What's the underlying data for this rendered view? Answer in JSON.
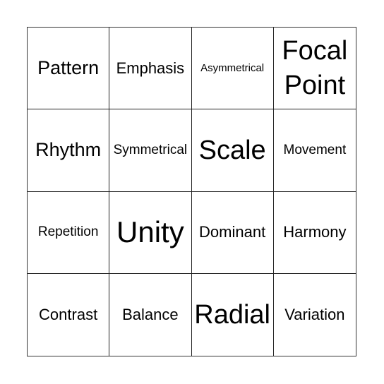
{
  "board": {
    "rows": [
      [
        {
          "text": "Pattern",
          "size": "s-lg"
        },
        {
          "text": "Emphasis",
          "size": "s-md"
        },
        {
          "text": "Asymmetrical",
          "size": "s-xs"
        },
        {
          "text": "Focal Point",
          "size": "s-xl"
        }
      ],
      [
        {
          "text": "Rhythm",
          "size": "s-lg"
        },
        {
          "text": "Symmetrical",
          "size": "s-sm"
        },
        {
          "text": "Scale",
          "size": "s-xl"
        },
        {
          "text": "Movement",
          "size": "s-sm"
        }
      ],
      [
        {
          "text": "Repetition",
          "size": "s-sm"
        },
        {
          "text": "Unity",
          "size": "s-xxl"
        },
        {
          "text": "Dominant",
          "size": "s-md"
        },
        {
          "text": "Harmony",
          "size": "s-md"
        }
      ],
      [
        {
          "text": "Contrast",
          "size": "s-md"
        },
        {
          "text": "Balance",
          "size": "s-md"
        },
        {
          "text": "Radial",
          "size": "s-xl"
        },
        {
          "text": "Variation",
          "size": "s-md"
        }
      ]
    ]
  }
}
